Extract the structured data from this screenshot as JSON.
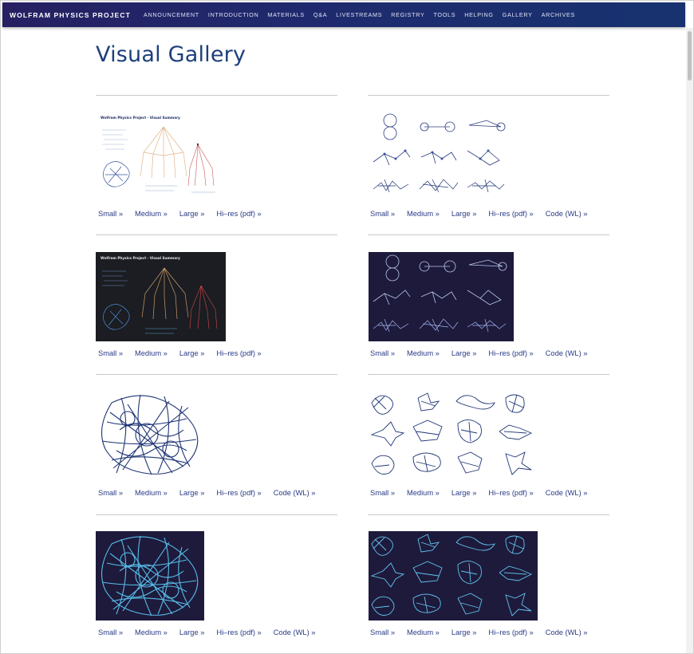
{
  "header": {
    "brand": "WOLFRAM PHYSICS PROJECT",
    "nav": [
      "ANNOUNCEMENT",
      "INTRODUCTION",
      "MATERIALS",
      "Q&A",
      "LIVESTREAMS",
      "REGISTRY",
      "TOOLS",
      "HELPING",
      "GALLERY",
      "ARCHIVES"
    ]
  },
  "page": {
    "title": "Visual Gallery"
  },
  "gallery": [
    {
      "links": [
        "Small »",
        "Medium »",
        "Large »",
        "Hi–res (pdf) »"
      ]
    },
    {
      "links": [
        "Small »",
        "Medium »",
        "Large »",
        "Hi–res (pdf) »",
        "Code (WL) »"
      ]
    },
    {
      "links": [
        "Small »",
        "Medium »",
        "Large »",
        "Hi–res (pdf) »"
      ]
    },
    {
      "links": [
        "Small »",
        "Medium »",
        "Large »",
        "Hi–res (pdf) »",
        "Code (WL) »"
      ]
    },
    {
      "links": [
        "Small »",
        "Medium »",
        "Large »",
        "Hi–res (pdf) »",
        "Code (WL) »"
      ]
    },
    {
      "links": [
        "Small »",
        "Medium »",
        "Large »",
        "Hi–res (pdf) »",
        "Code (WL) »"
      ]
    },
    {
      "links": [
        "Small »",
        "Medium »",
        "Large »",
        "Hi–res (pdf) »",
        "Code (WL) »"
      ]
    },
    {
      "links": [
        "Small »",
        "Medium »",
        "Large »",
        "Hi–res (pdf) »",
        "Code (WL) »"
      ]
    }
  ],
  "colors": {
    "link": "#2a3a86",
    "title": "#1d3f7c",
    "dark_bg": "#1c1b3a",
    "graph_blue": "#1f3575",
    "graph_cyan": "#4fb8e6"
  }
}
